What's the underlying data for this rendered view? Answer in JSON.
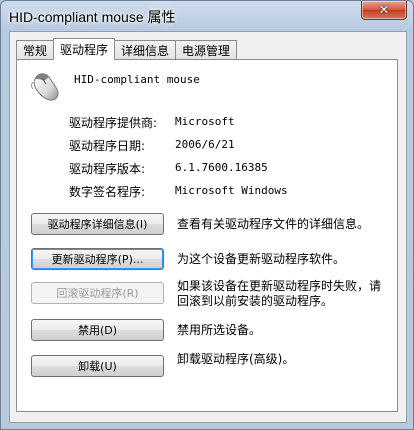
{
  "window": {
    "title": "HID-compliant mouse 属性",
    "close_glyph": "✕"
  },
  "tabs": [
    {
      "label": "常规",
      "active": false
    },
    {
      "label": "驱动程序",
      "active": true
    },
    {
      "label": "详细信息",
      "active": false
    },
    {
      "label": "电源管理",
      "active": false
    }
  ],
  "device": {
    "name": "HID-compliant mouse",
    "icon": "mouse-icon"
  },
  "info": [
    {
      "label": "驱动程序提供商:",
      "value": "Microsoft"
    },
    {
      "label": "驱动程序日期:",
      "value": "2006/6/21"
    },
    {
      "label": "驱动程序版本:",
      "value": "6.1.7600.16385"
    },
    {
      "label": "数字签名程序:",
      "value": "Microsoft Windows"
    }
  ],
  "actions": [
    {
      "label": "驱动程序详细信息(I)",
      "description": "查看有关驱动程序文件的详细信息。",
      "enabled": true
    },
    {
      "label": "更新驱动程序(P)...",
      "description": "为这个设备更新驱动程序软件。",
      "enabled": true
    },
    {
      "label": "回滚驱动程序(R)",
      "description": "如果该设备在更新驱动程序时失败，请回滚到以前安装的驱动程序。",
      "enabled": false
    },
    {
      "label": "禁用(D)",
      "description": "禁用所选设备。",
      "enabled": true
    },
    {
      "label": "卸载(U)",
      "description": "卸载驱动程序(高级)。",
      "enabled": true
    }
  ]
}
